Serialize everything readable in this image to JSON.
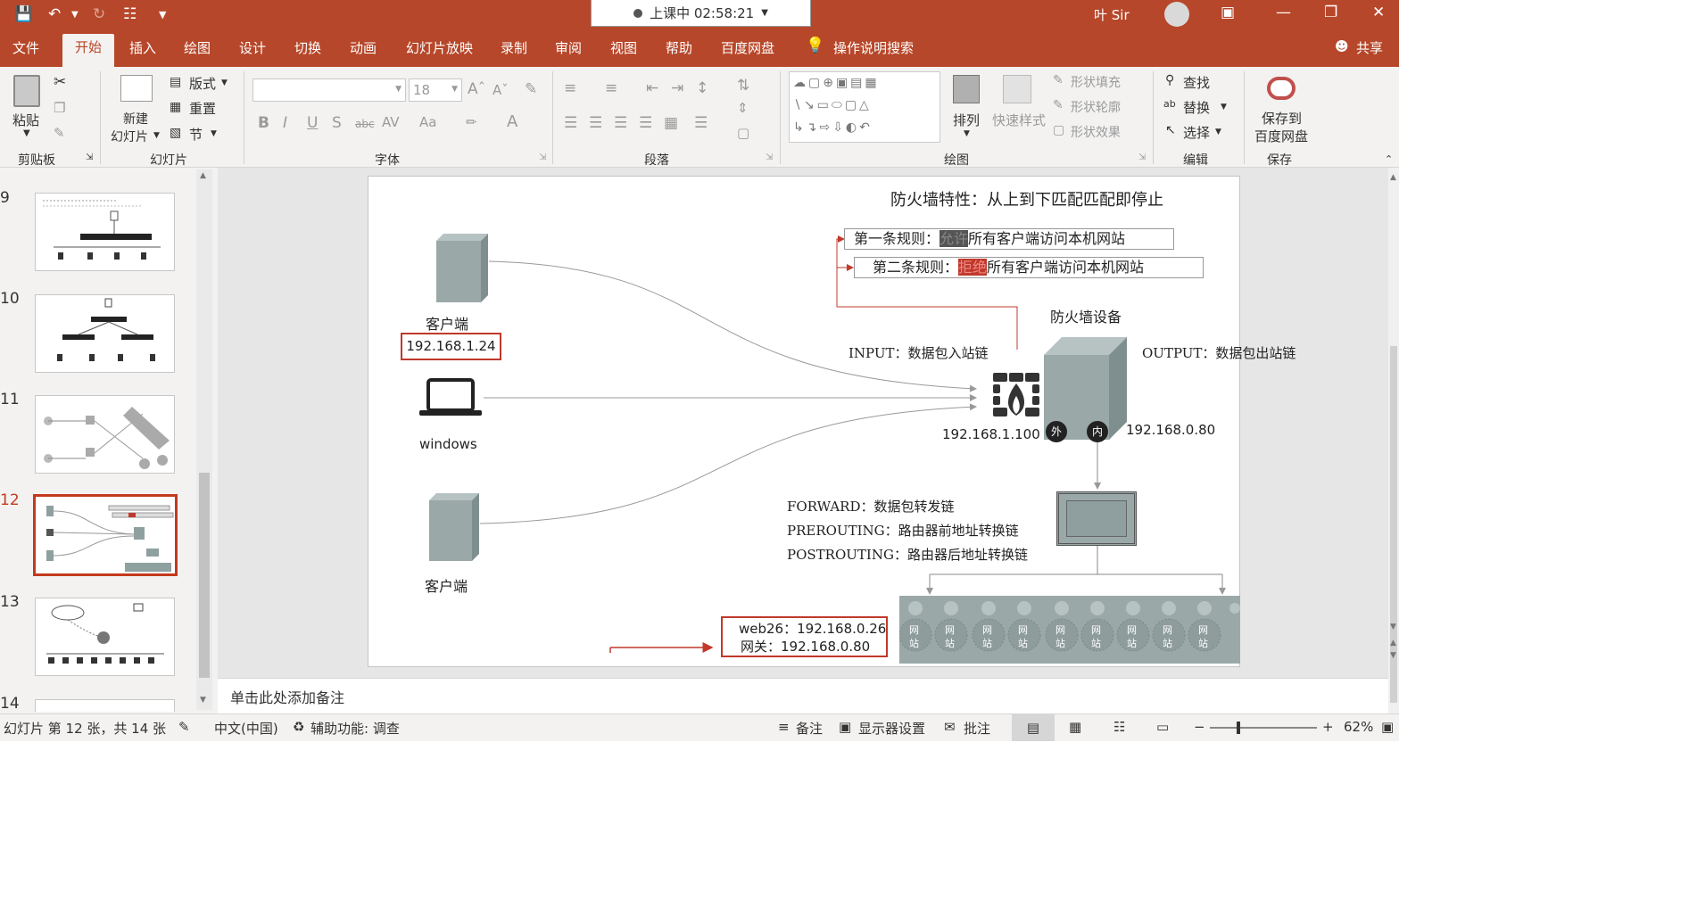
{
  "titlebar": {
    "class_status": "上课中 02:58:21",
    "user": "叶 Sir"
  },
  "tabs": [
    "文件",
    "开始",
    "插入",
    "绘图",
    "设计",
    "切换",
    "动画",
    "幻灯片放映",
    "录制",
    "审阅",
    "视图",
    "帮助",
    "百度网盘"
  ],
  "tell_me": "操作说明搜索",
  "share": "共享",
  "ribbon": {
    "paste": "粘贴",
    "clipboard_group": "剪贴板",
    "new_slide": "新建",
    "new_slide2": "幻灯片",
    "layout": "版式",
    "reset": "重置",
    "section": "节",
    "slides_group": "幻灯片",
    "font_size": "18",
    "font_group": "字体",
    "paragraph_group": "段落",
    "arrange": "排列",
    "quick_styles": "快速样式",
    "shape_fill": "形状填充",
    "shape_outline": "形状轮廓",
    "shape_effects": "形状效果",
    "drawing_group": "绘图",
    "find": "查找",
    "replace": "替换",
    "select": "选择",
    "editing_group": "编辑",
    "save_to": "保存到",
    "baidu_disk": "百度网盘",
    "save_group": "保存"
  },
  "thumbnails": [
    {
      "num": "9",
      "selected": false
    },
    {
      "num": "10",
      "selected": false
    },
    {
      "num": "11",
      "selected": false
    },
    {
      "num": "12",
      "selected": true
    },
    {
      "num": "13",
      "selected": false
    },
    {
      "num": "14",
      "selected": false
    }
  ],
  "slide": {
    "title": "防火墙特性：从上到下匹配匹配即停止",
    "rule1_prefix": "第一条规则：",
    "rule1_action": "允许",
    "rule1_suffix": "所有客户端访问本机网站",
    "rule2_prefix": "第二条规则：",
    "rule2_action": "拒绝",
    "rule2_suffix": "所有客户端访问本机网站",
    "client_top": "客户端",
    "client_ip": "192.168.1.24",
    "windows": "windows",
    "client_bottom": "客户端",
    "firewall_device": "防火墙设备",
    "input_chain": "INPUT：数据包入站链",
    "output_chain": "OUTPUT：数据包出站链",
    "outer_ip": "192.168.1.100",
    "outer_label": "外",
    "inner_label": "内",
    "inner_ip": "192.168.0.80",
    "forward": "FORWARD：数据包转发链",
    "prerouting": "PREROUTING：路由器前地址转换链",
    "postrouting": "POSTROUTING：路由器后地址转换链",
    "web_line1": "web26：192.168.0.26",
    "web_line2": "网关：192.168.0.80",
    "site_char1": "网",
    "site_char2": "站"
  },
  "notes_placeholder": "单击此处添加备注",
  "status": {
    "slide_info": "幻灯片 第 12 张，共 14 张",
    "language": "中文(中国)",
    "accessibility": "辅助功能: 调查",
    "notes": "备注",
    "display_settings": "显示器设置",
    "comments": "批注",
    "zoom": "62%"
  },
  "colors": {
    "accent": "#b7472a",
    "rule_red": "#c0392b",
    "server_gray": "#9aa8a8"
  }
}
